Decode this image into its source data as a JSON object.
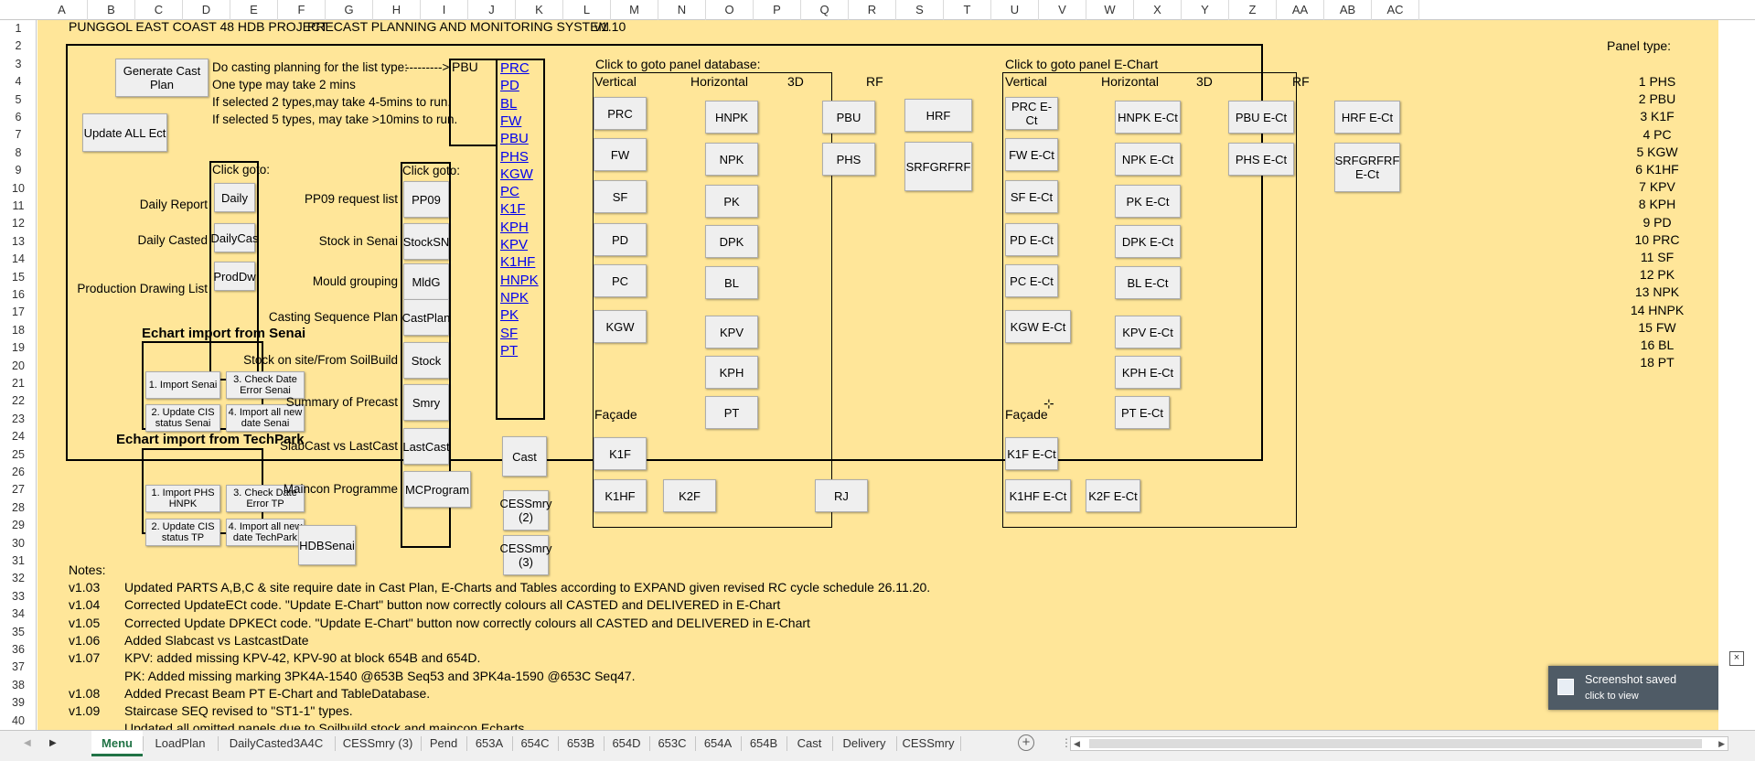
{
  "columns": [
    "A",
    "B",
    "C",
    "D",
    "E",
    "F",
    "G",
    "H",
    "I",
    "J",
    "K",
    "L",
    "M",
    "N",
    "O",
    "P",
    "Q",
    "R",
    "S",
    "T",
    "U",
    "V",
    "W",
    "X",
    "Y",
    "Z",
    "AA",
    "AB",
    "AC"
  ],
  "rows": [
    "1",
    "2",
    "3",
    "4",
    "5",
    "6",
    "7",
    "8",
    "9",
    "10",
    "11",
    "12",
    "13",
    "14",
    "15",
    "16",
    "17",
    "18",
    "19",
    "20",
    "21",
    "22",
    "23",
    "24",
    "25",
    "26",
    "27",
    "28",
    "29",
    "30",
    "31",
    "32",
    "33",
    "34",
    "35",
    "36",
    "37",
    "38",
    "39",
    "40"
  ],
  "header": {
    "project": "PUNGGOL EAST COAST 48 HDB PROJECT",
    "system": "PRECAST PLANNING AND MONITORING SYSTEM",
    "version": "v1.10"
  },
  "casting": {
    "button": "Generate Cast Plan",
    "line1": "Do casting planning for the list type:",
    "arrow": "--------->",
    "line2": "One type may take 2 mins",
    "line3": "If selected 2 types,may take 4-5mins to run.",
    "line4": "If selected 5 types, may take >10mins to run.",
    "pbu": "PBU"
  },
  "update_all": "Update ALL Ect",
  "types_list": [
    "PRC",
    "PD",
    "BL",
    "FW",
    "PBU",
    "PHS",
    "KGW",
    "PC",
    "K1F",
    "KPH",
    "KPV",
    "K1HF",
    "HNPK",
    "NPK",
    "PK",
    "SF",
    "PT"
  ],
  "goto_small": {
    "title": "Click goto:",
    "daily_label": "Daily Report",
    "daily_btn": "Daily",
    "dailycas_label": "Daily Casted",
    "dailycas_btn": "DailyCas",
    "prod_label": "Production Drawing List",
    "prod_btn": "ProdDw"
  },
  "goto_mid": {
    "title": "Click goto:",
    "items": [
      {
        "label": "PP09 request list",
        "btn": "PP09"
      },
      {
        "label": "Stock in Senai",
        "btn": "StockSN"
      },
      {
        "label": "Mould grouping",
        "btn": "MldG"
      },
      {
        "label": "Casting Sequence Plan",
        "btn": "CastPlan"
      },
      {
        "label": "Stock on site/From SoilBuild",
        "btn": "Stock"
      },
      {
        "label": "Summary of Precast",
        "btn": "Smry"
      },
      {
        "label": "SlabCast vs LastCast",
        "btn": "LastCast"
      },
      {
        "label": "Maincon Programme",
        "btn": "MCProgram"
      }
    ]
  },
  "cast_btn": "Cast",
  "cessmry2": "CESSmry\n(2)",
  "cessmry3": "CESSmry\n(3)",
  "hdbsenai": "HDBSenai",
  "echart_senai": {
    "title": "Echart import from Senai",
    "b1": "1. Import Senai",
    "b2": "3. Check Date\nError Senai",
    "b3": "2. Update CIS\nstatus Senai",
    "b4": "4. Import all new\ndate Senai"
  },
  "echart_tp": {
    "title": "Echart import from TechPark",
    "b1": "1. Import PHS\nHNPK",
    "b2": "3. Check Date\nError TP",
    "b3": "2. Update CIS\nstatus TP",
    "b4": "4. Import all new\ndate TechPark"
  },
  "panel_db": {
    "title": "Click to goto panel database:",
    "vertical": "Vertical",
    "horizontal": "Horizontal",
    "threed": "3D",
    "rf": "RF",
    "facade": "Façade",
    "v": [
      "PRC",
      "FW",
      "SF",
      "PD",
      "PC",
      "KGW"
    ],
    "h": [
      "HNPK",
      "NPK",
      "PK",
      "DPK",
      "BL",
      "KPV",
      "KPH",
      "PT"
    ],
    "d3": [
      "PBU",
      "PHS"
    ],
    "rfb": [
      "HRF",
      "SRFGRFRF"
    ],
    "fac": [
      "K1F",
      "K1HF",
      "K2F",
      "RJ"
    ]
  },
  "panel_ec": {
    "title": "Click to goto panel E-Chart",
    "vertical": "Vertical",
    "horizontal": "Horizontal",
    "threed": "3D",
    "rf": "RF",
    "facade": "Façade",
    "v": [
      "PRC E-Ct",
      "FW E-Ct",
      "SF E-Ct",
      "PD E-Ct",
      "PC E-Ct",
      "KGW E-Ct"
    ],
    "h": [
      "HNPK E-Ct",
      "NPK E-Ct",
      "PK E-Ct",
      "DPK E-Ct",
      "BL E-Ct",
      "KPV E-Ct",
      "KPH E-Ct",
      "PT E-Ct"
    ],
    "d3": [
      "PBU E-Ct",
      "PHS E-Ct"
    ],
    "rfb": [
      "HRF E-Ct",
      "SRFGRFRF\nE-Ct"
    ],
    "fac": [
      "K1F E-Ct",
      "K1HF E-Ct",
      "K2F E-Ct"
    ]
  },
  "panel_type": {
    "title": "Panel type:",
    "items": [
      "1 PHS",
      "2 PBU",
      "3 K1F",
      "4 PC",
      "5 KGW",
      "6 K1HF",
      "7 KPV",
      "8 KPH",
      "9 PD",
      "10 PRC",
      "11 SF",
      "12 PK",
      "13 NPK",
      "14 HNPK",
      "15 FW",
      "16 BL",
      "18 PT"
    ]
  },
  "notes": {
    "title": "Notes:",
    "items": [
      {
        "v": "v1.03",
        "t": "Updated PARTS A,B,C & site require date in Cast Plan, E-Charts and Tables according to EXPAND given revised RC cycle schedule 26.11.20."
      },
      {
        "v": "v1.04",
        "t": "Corrected UpdateECt code. \"Update E-Chart\" button now correctly colours all CASTED and DELIVERED in E-Chart"
      },
      {
        "v": "v1.05",
        "t": "Corrected Update DPKECt code. \"Update E-Chart\" button now correctly colours all CASTED and DELIVERED in E-Chart"
      },
      {
        "v": "v1.06",
        "t": "Added Slabcast vs LastcastDate"
      },
      {
        "v": "v1.07",
        "t": "KPV: added missing KPV-42, KPV-90 at block 654B and 654D."
      },
      {
        "v": "",
        "t": "PK: Added missing marking 3PK4A-1540 @653B Seq53 and 3PK4a-1590 @653C Seq47."
      },
      {
        "v": "v1.08",
        "t": "Added Precast Beam PT E-Chart and TableDatabase."
      },
      {
        "v": "v1.09",
        "t": "Staircase SEQ revised to \"ST1-1\" types."
      },
      {
        "v": "",
        "t": "Updated all omitted panels due to Soilbuild stock and maincon Echarts"
      }
    ]
  },
  "tabs": [
    "Menu",
    "LoadPlan",
    "DailyCasted3A4C",
    "CESSmry (3)",
    "Pend",
    "653A",
    "654C",
    "653B",
    "654D",
    "653C",
    "654A",
    "654B",
    "Cast",
    "Delivery",
    "CESSmry ..."
  ],
  "toast": {
    "title": "Screenshot saved",
    "sub": "click to view"
  }
}
